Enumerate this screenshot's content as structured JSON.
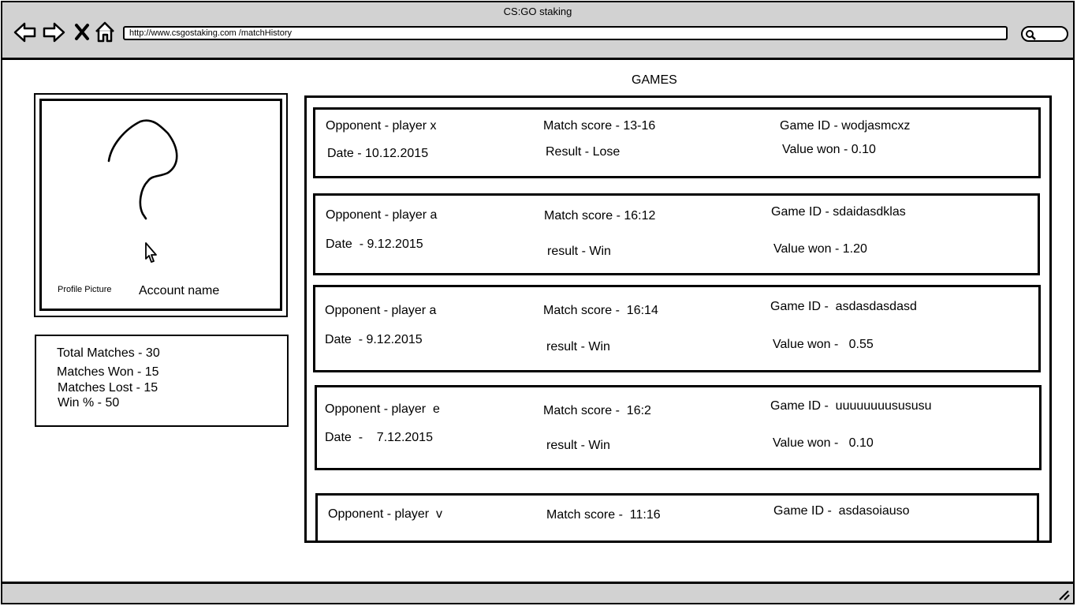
{
  "window": {
    "title": "CS:GO staking",
    "url": "http://www.csgostaking.com /matchHistory"
  },
  "profile": {
    "picture_label": "Profile Picture",
    "account_name": "Account name"
  },
  "stats": {
    "total": "Total Matches - 30",
    "won": "Matches Won - 15",
    "lost": "Matches Lost -  15",
    "win_pct": "Win % - 50"
  },
  "games": {
    "title": "GAMES",
    "items": [
      {
        "opponent": "Opponent - player x",
        "date": "Date - 10.12.2015",
        "score": "Match score - 13-16",
        "result": "Result - Lose",
        "game_id": "Game ID - wodjasmcxz",
        "value": "Value won - 0.10"
      },
      {
        "opponent": "Opponent - player a",
        "date": "Date  - 9.12.2015",
        "score": "Match score - 16:12",
        "result": "result - Win",
        "game_id": "Game ID - sdaidasdklas",
        "value": "Value won - 1.20"
      },
      {
        "opponent": "Opponent - player a",
        "date": "Date  - 9.12.2015",
        "score": "Match score -  16:14",
        "result": "result - Win",
        "game_id": "Game ID -  asdasdasdasd",
        "value": "Value won -   0.55"
      },
      {
        "opponent": "Opponent - player  e",
        "date": "Date  -    7.12.2015",
        "score": "Match score -  16:2",
        "result": "result - Win",
        "game_id": "Game ID -  uuuuuuuusususu",
        "value": "Value won -   0.10"
      },
      {
        "opponent": "Opponent - player  v",
        "date": "",
        "score": "Match score -  11:16",
        "result": "",
        "game_id": "Game ID -  asdasoiauso",
        "value": ""
      }
    ]
  }
}
